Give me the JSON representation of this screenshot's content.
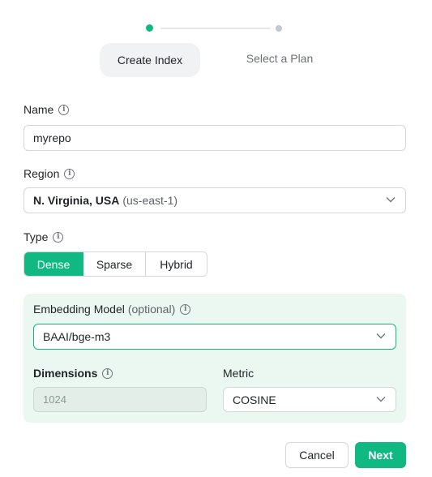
{
  "stepper": {
    "steps": [
      {
        "label": "Create Index",
        "active": true
      },
      {
        "label": "Select a Plan",
        "active": false
      }
    ]
  },
  "name": {
    "label": "Name",
    "value": "myrepo"
  },
  "region": {
    "label": "Region",
    "value_main": "N. Virginia, USA",
    "value_code": "(us-east-1)"
  },
  "type": {
    "label": "Type",
    "options": [
      "Dense",
      "Sparse",
      "Hybrid"
    ],
    "selected": "Dense"
  },
  "embedding": {
    "label": "Embedding Model",
    "optional": "(optional)",
    "value": "BAAI/bge-m3"
  },
  "dimensions": {
    "label": "Dimensions",
    "value": "1024"
  },
  "metric": {
    "label": "Metric",
    "value": "COSINE"
  },
  "actions": {
    "cancel": "Cancel",
    "next": "Next"
  },
  "colors": {
    "accent": "#10b981",
    "panel_bg": "#ebf8f2"
  }
}
